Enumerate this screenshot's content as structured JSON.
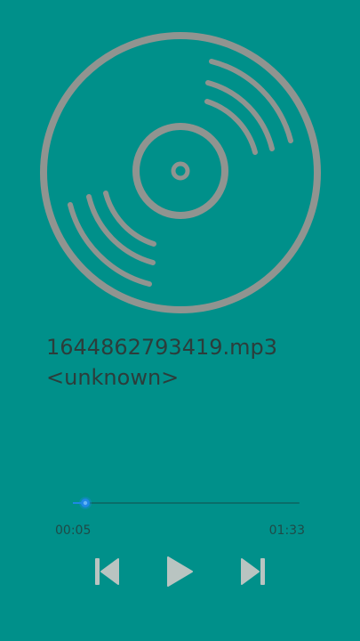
{
  "track": {
    "title": "1644862793419.mp3",
    "artist": "<unknown>"
  },
  "album_art": {
    "icon": "vinyl-record-icon",
    "color": "#909490"
  },
  "playback": {
    "elapsed": "00:05",
    "total": "01:33",
    "progress_fraction": 0.054
  },
  "controls": {
    "previous_icon": "skip-previous-icon",
    "play_icon": "play-icon",
    "next_icon": "skip-next-icon",
    "icon_color": "#b9c4c1"
  },
  "colors": {
    "background": "#00908a",
    "text": "#2c3d3b",
    "accent": "#1e88e5"
  }
}
